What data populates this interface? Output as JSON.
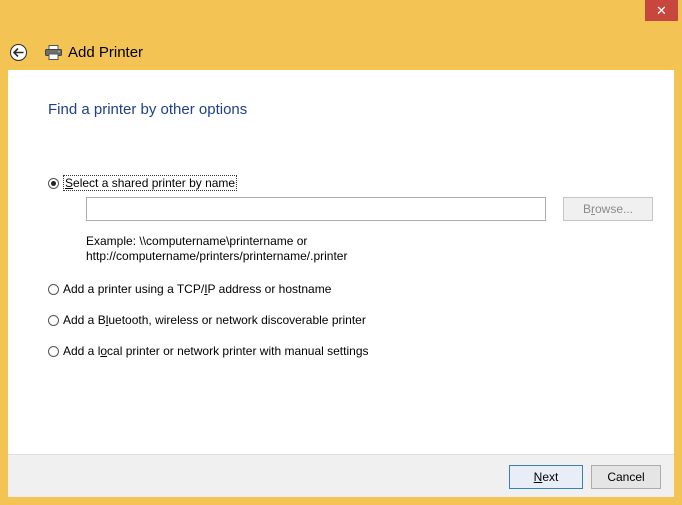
{
  "window": {
    "title": "Add Printer",
    "close_symbol": "✕"
  },
  "main": {
    "heading": "Find a printer by other options",
    "options": [
      {
        "label_pre": "",
        "label_key": "S",
        "label_post": "elect a shared printer by name",
        "checked": true
      },
      {
        "label_pre": "Add a printer using a TCP/",
        "label_key": "I",
        "label_post": "P address or hostname",
        "checked": false
      },
      {
        "label_pre": "Add a B",
        "label_key": "l",
        "label_post": "uetooth, wireless or network discoverable printer",
        "checked": false
      },
      {
        "label_pre": "Add a l",
        "label_key": "o",
        "label_post": "cal printer or network printer with manual settings",
        "checked": false
      }
    ],
    "name_input": {
      "value": "",
      "placeholder": ""
    },
    "browse_label_pre": "B",
    "browse_label_key": "r",
    "browse_label_post": "owse...",
    "example_line1": "Example: \\\\computername\\printername or",
    "example_line2": "http://computername/printers/printername/.printer"
  },
  "footer": {
    "next_key": "N",
    "next_post": "ext",
    "cancel_label": "Cancel"
  },
  "icons": {
    "back": "back-arrow-icon",
    "printer": "printer-icon",
    "close": "close-icon"
  }
}
